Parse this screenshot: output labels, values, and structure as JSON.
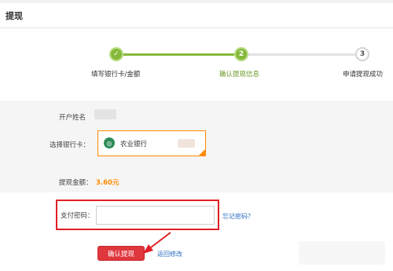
{
  "page": {
    "title": "提现"
  },
  "steps": [
    {
      "num": "✓",
      "label": "填写银行卡/金额",
      "state": "done"
    },
    {
      "num": "2",
      "label": "确认提现信息",
      "state": "current"
    },
    {
      "num": "3",
      "label": "申请提现成功",
      "state": "pending"
    }
  ],
  "form": {
    "account_name_label": "开户姓名",
    "bank_card_label": "选择银行卡：",
    "bank_name": "农业银行",
    "amount_label": "提现金额：",
    "amount_value": "3.60元",
    "password_label": "支付密码：",
    "password_value": "",
    "forgot_password": "忘记密码？"
  },
  "actions": {
    "confirm": "确认提现",
    "back": "返回修改"
  },
  "colors": {
    "step_done": "#86b93a",
    "amount": "#ff8a00",
    "highlight": "#e01e27",
    "confirm_button": "#e0363d",
    "link": "#2b6cbf"
  },
  "icons": {
    "bank": "abc-bank-icon",
    "step_check": "check-icon"
  }
}
